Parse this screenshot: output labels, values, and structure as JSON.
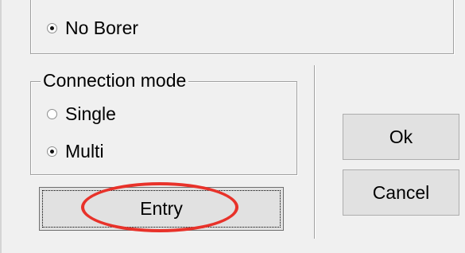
{
  "borer_group": {
    "options": [
      {
        "label": "No Borer",
        "checked": true
      }
    ]
  },
  "connection_mode": {
    "title": "Connection mode",
    "options": [
      {
        "label": "Single",
        "checked": false
      },
      {
        "label": "Multi",
        "checked": true
      }
    ]
  },
  "buttons": {
    "entry": "Entry",
    "ok": "Ok",
    "cancel": "Cancel"
  },
  "colors": {
    "annotation": "#e8322a",
    "background": "#f0f0f0"
  }
}
